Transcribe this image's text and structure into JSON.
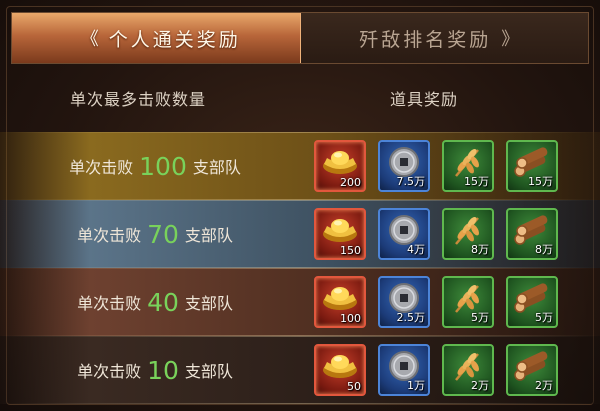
{
  "tabs": {
    "personal": {
      "chev": "《",
      "label": "个人通关奖励"
    },
    "ranking": {
      "label": "歼敌排名奖励",
      "chev": "》"
    }
  },
  "headers": {
    "kills": "单次最多击败数量",
    "rewards": "道具奖励"
  },
  "rows": [
    {
      "prefix": "单次击败",
      "count": "100",
      "suffix": "支部队",
      "rewards": [
        {
          "icon": "gold-ingot-icon",
          "qty": "200"
        },
        {
          "icon": "copper-coin-icon",
          "qty": "7.5万"
        },
        {
          "icon": "wheat-icon",
          "qty": "15万"
        },
        {
          "icon": "wood-logs-icon",
          "qty": "15万"
        }
      ]
    },
    {
      "prefix": "单次击败",
      "count": "70",
      "suffix": "支部队",
      "rewards": [
        {
          "icon": "gold-ingot-icon",
          "qty": "150"
        },
        {
          "icon": "copper-coin-icon",
          "qty": "4万"
        },
        {
          "icon": "wheat-icon",
          "qty": "8万"
        },
        {
          "icon": "wood-logs-icon",
          "qty": "8万"
        }
      ]
    },
    {
      "prefix": "单次击败",
      "count": "40",
      "suffix": "支部队",
      "rewards": [
        {
          "icon": "gold-ingot-icon",
          "qty": "100"
        },
        {
          "icon": "copper-coin-icon",
          "qty": "2.5万"
        },
        {
          "icon": "wheat-icon",
          "qty": "5万"
        },
        {
          "icon": "wood-logs-icon",
          "qty": "5万"
        }
      ]
    },
    {
      "prefix": "单次击败",
      "count": "10",
      "suffix": "支部队",
      "rewards": [
        {
          "icon": "gold-ingot-icon",
          "qty": "50"
        },
        {
          "icon": "copper-coin-icon",
          "qty": "1万"
        },
        {
          "icon": "wheat-icon",
          "qty": "2万"
        },
        {
          "icon": "wood-logs-icon",
          "qty": "2万"
        }
      ]
    }
  ],
  "colors": {
    "count_green": "#79d25b",
    "tab_active": "#b8663a"
  }
}
